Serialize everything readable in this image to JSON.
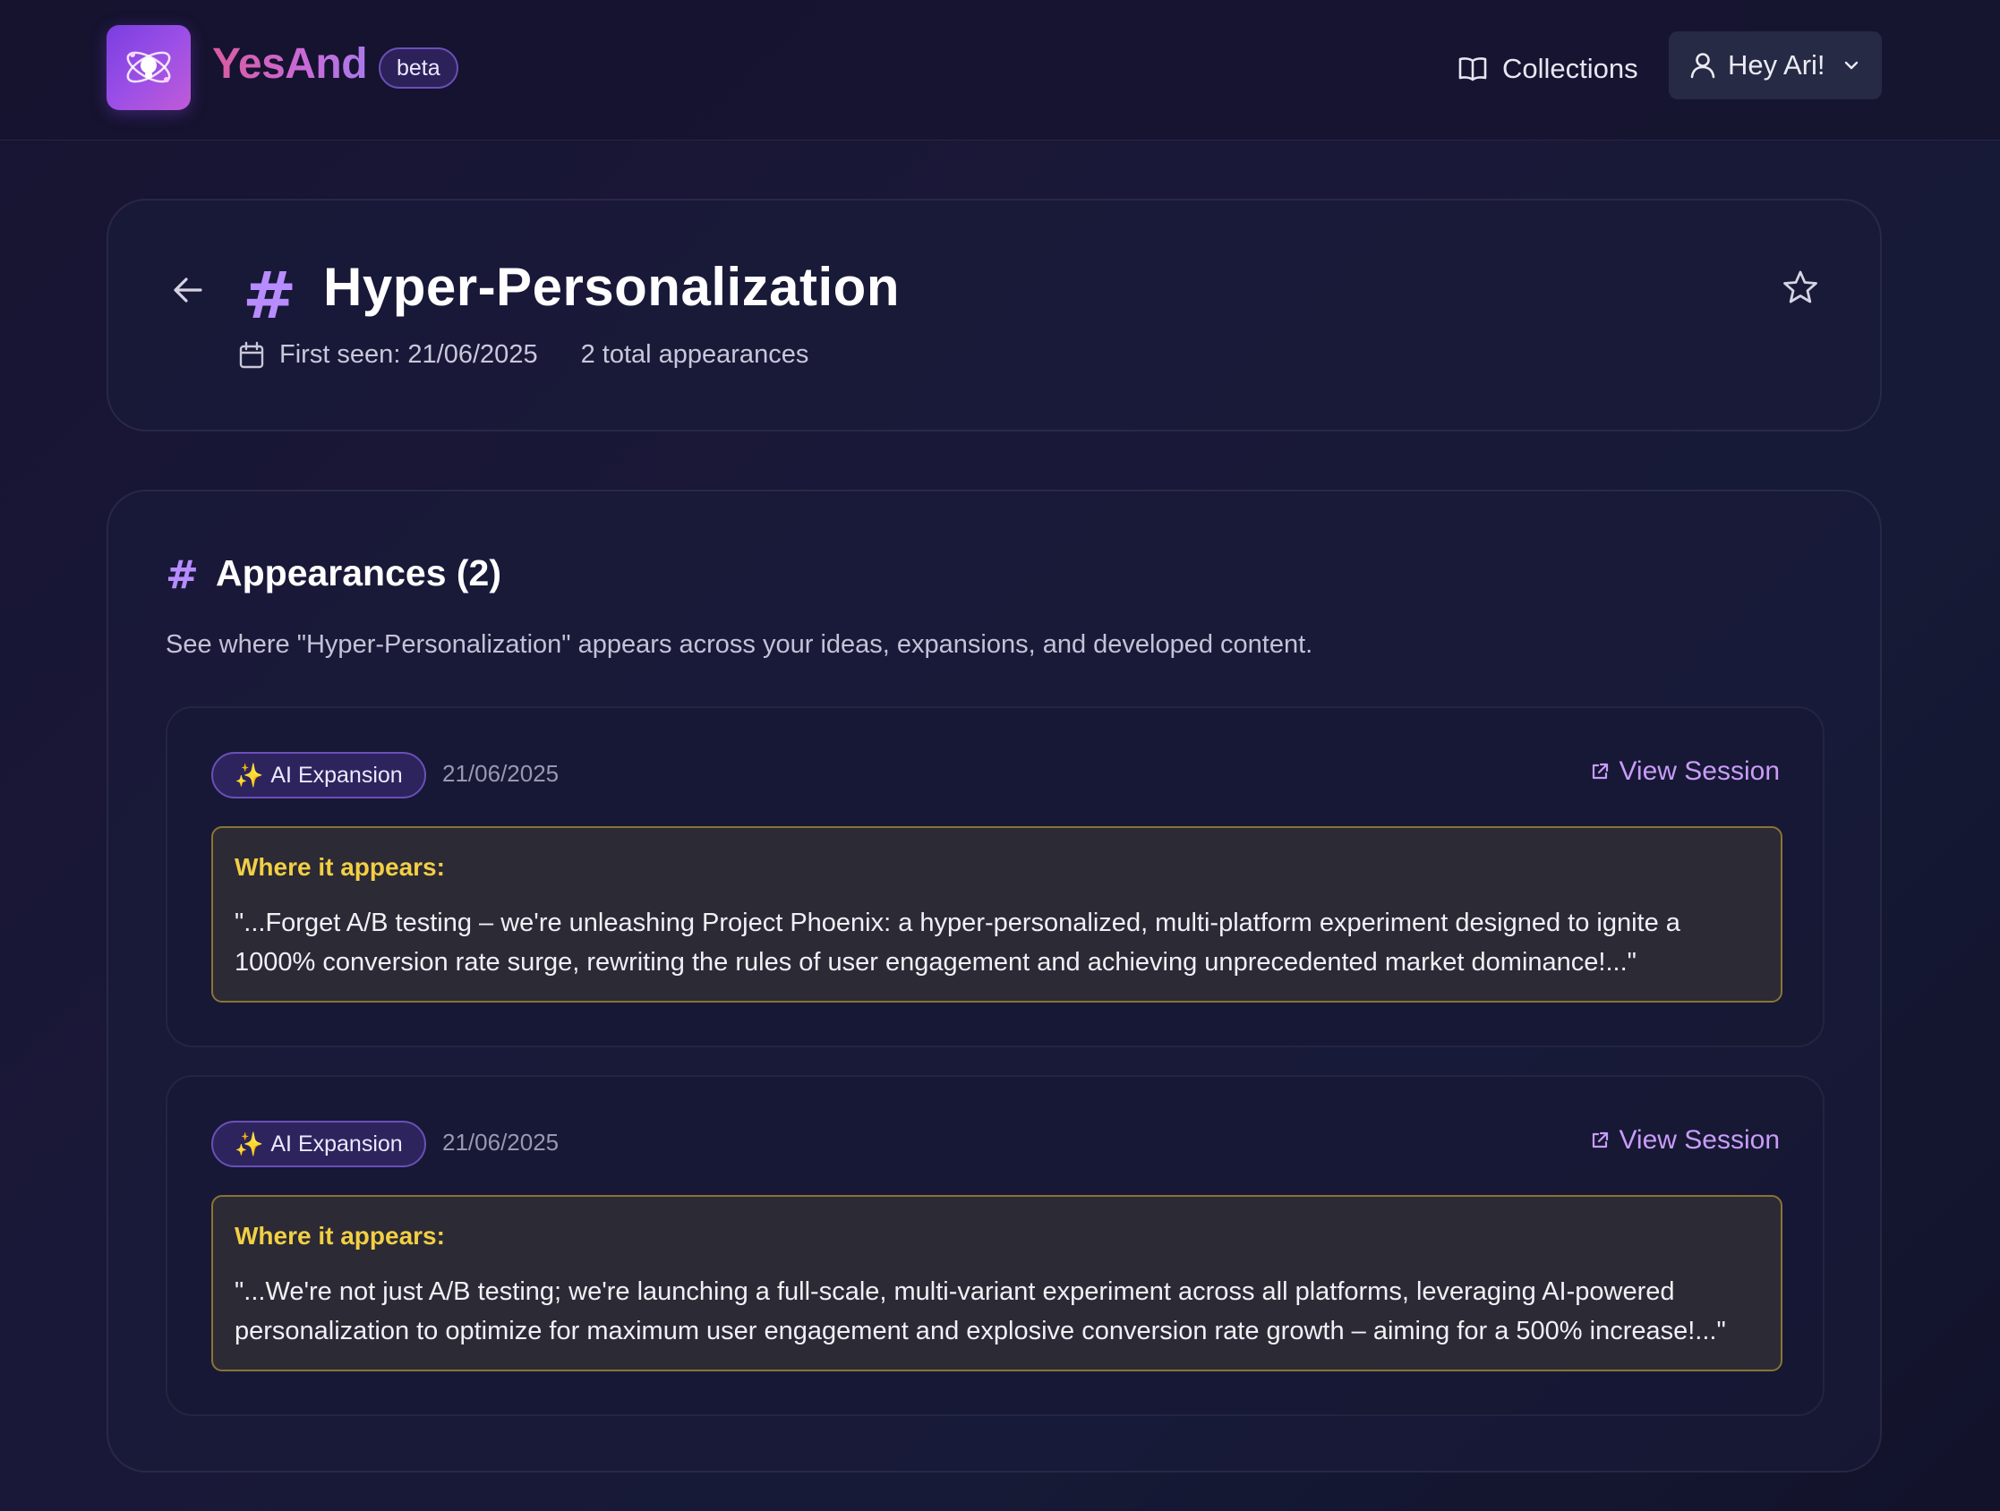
{
  "header": {
    "brand": "YesAnd",
    "beta_label": "beta",
    "collections_label": "Collections",
    "user_label": "Hey Ari!",
    "icons": {
      "logo": "atom-bulb-icon",
      "collections": "book-open-icon",
      "user": "user-icon",
      "dropdown": "chevron-down-icon"
    }
  },
  "topic": {
    "hash": "#",
    "title": "Hyper-Personalization",
    "first_seen": "First seen: 21/06/2025",
    "total_appearances": "2 total appearances"
  },
  "appearances": {
    "hash": "#",
    "title": "Appearances (2)",
    "description": "See where \"Hyper-Personalization\" appears across your ideas, expansions, and developed content.",
    "items": [
      {
        "badge": "AI Expansion",
        "badge_icon": "✨",
        "date": "21/06/2025",
        "view_label": "View Session",
        "where_label": "Where it appears:",
        "quote": "\"...Forget A/B testing – we're unleashing Project Phoenix: a hyper-personalized, multi-platform experiment designed to ignite a 1000% conversion rate surge, rewriting the rules of user engagement and achieving unprecedented market dominance!...\""
      },
      {
        "badge": "AI Expansion",
        "badge_icon": "✨",
        "date": "21/06/2025",
        "view_label": "View Session",
        "where_label": "Where it appears:",
        "quote": "\"...We're not just A/B testing; we're launching a full-scale, multi-variant experiment across all platforms, leveraging AI-powered personalization to optimize for maximum user engagement and explosive conversion rate growth – aiming for a 500% increase!...\""
      }
    ]
  },
  "colors": {
    "accent_purple": "#b78cff",
    "link_purple": "#c99cf8",
    "highlight_yellow": "#f2cf45",
    "brand_pink": "#d95ba0"
  }
}
